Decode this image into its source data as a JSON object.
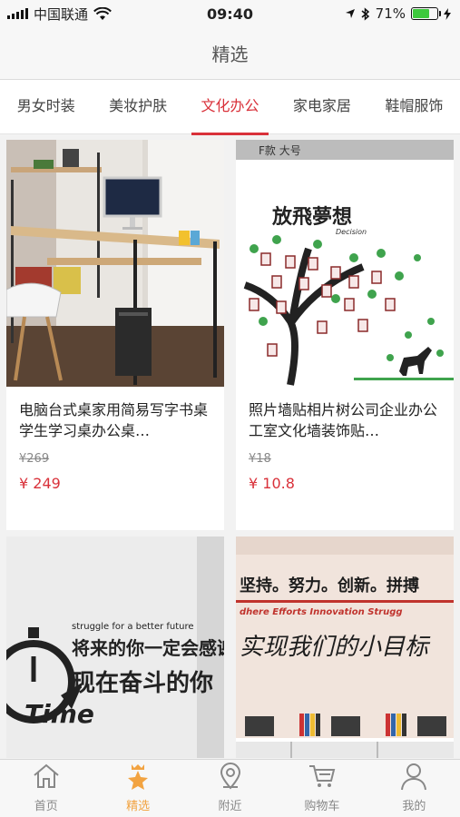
{
  "status": {
    "carrier": "中国联通",
    "time": "09:40",
    "battery": "71%",
    "battery_level": 0.71
  },
  "nav": {
    "title": "精选"
  },
  "tabs": [
    "男女时装",
    "美妆护肤",
    "文化办公",
    "家电家居",
    "鞋帽服饰"
  ],
  "active_tab": 2,
  "products": [
    {
      "name": "电脑台式桌家用简易写字书桌学生学习桌办公桌…",
      "old_price": "¥269",
      "price": "¥ 249"
    },
    {
      "name": "照片墙贴相片树公司企业办公工室文化墙装饰贴…",
      "old_price": "¥18",
      "price": "¥ 10.8",
      "image_text": {
        "top": "F款 大号",
        "heading": "放飛夢想",
        "sub": "Decision"
      }
    },
    {
      "image_text": {
        "line1": "struggle for a better future",
        "line2": "将来的你一定会感谢",
        "line3": "现在奋斗的你",
        "line4": "Time"
      }
    },
    {
      "image_text": {
        "line1": "坚持。努力。创新。拼搏",
        "line2": "dhere   Efforts   Innovation Strugg",
        "line3": "实现我们的小目标"
      }
    }
  ],
  "tabbar": [
    {
      "label": "首页",
      "icon": "home-icon"
    },
    {
      "label": "精选",
      "icon": "star-crown-icon"
    },
    {
      "label": "附近",
      "icon": "location-pin-icon"
    },
    {
      "label": "购物车",
      "icon": "cart-icon"
    },
    {
      "label": "我的",
      "icon": "user-icon"
    }
  ],
  "colors": {
    "accent": "#d9313a",
    "tab_active": "#f2a341",
    "battery": "#3cc93c"
  }
}
